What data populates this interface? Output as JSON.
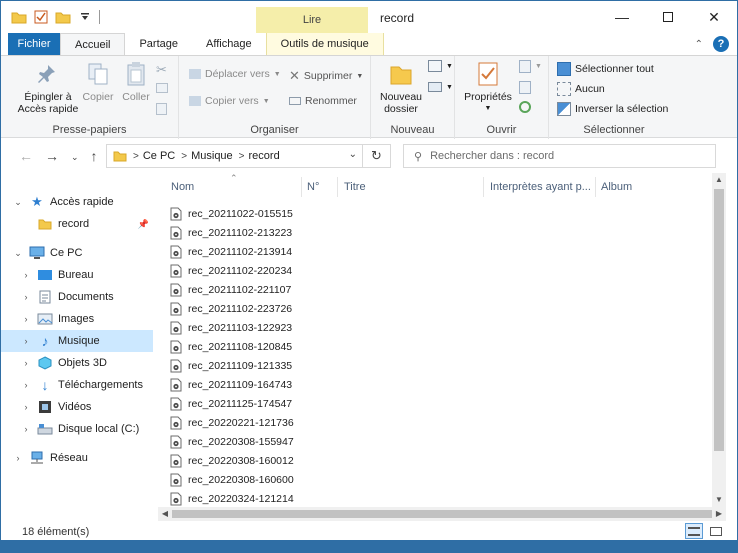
{
  "window": {
    "title": "record",
    "context_tab": "Lire"
  },
  "tabs": {
    "file": "Fichier",
    "home": "Accueil",
    "share": "Partage",
    "view": "Affichage",
    "music_tools": "Outils de musique"
  },
  "ribbon": {
    "clipboard": {
      "label": "Presse-papiers",
      "pin": "Épingler à\nAccès rapide",
      "copy": "Copier",
      "paste": "Coller"
    },
    "organize": {
      "label": "Organiser",
      "move_to": "Déplacer vers",
      "copy_to": "Copier vers",
      "delete": "Supprimer",
      "rename": "Renommer"
    },
    "new": {
      "label": "Nouveau",
      "new_folder": "Nouveau\ndossier"
    },
    "open": {
      "label": "Ouvrir",
      "properties": "Propriétés"
    },
    "select": {
      "label": "Sélectionner",
      "select_all": "Sélectionner tout",
      "select_none": "Aucun",
      "invert": "Inverser la sélection"
    }
  },
  "address": {
    "crumbs": [
      "Ce PC",
      "Musique",
      "record"
    ],
    "search_placeholder": "Rechercher dans : record"
  },
  "nav": {
    "quick_access": "Accès rapide",
    "record": "record",
    "this_pc": "Ce PC",
    "desktop": "Bureau",
    "documents": "Documents",
    "images": "Images",
    "music": "Musique",
    "objects3d": "Objets 3D",
    "downloads": "Téléchargements",
    "videos": "Vidéos",
    "local_disk": "Disque local (C:)",
    "network": "Réseau"
  },
  "columns": {
    "name": "Nom",
    "number": "N°",
    "title": "Titre",
    "artists": "Interprètes ayant p...",
    "album": "Album"
  },
  "files": [
    "rec_20211022-015515",
    "rec_20211102-213223",
    "rec_20211102-213914",
    "rec_20211102-220234",
    "rec_20211102-221107",
    "rec_20211102-223726",
    "rec_20211103-122923",
    "rec_20211108-120845",
    "rec_20211109-121335",
    "rec_20211109-164743",
    "rec_20211125-174547",
    "rec_20220221-121736",
    "rec_20220308-155947",
    "rec_20220308-160012",
    "rec_20220308-160600",
    "rec_20220324-121214"
  ],
  "status": {
    "count": "18 élément(s)"
  },
  "colors": {
    "accent": "#1a6fb5",
    "context_tab": "#f5eeaa",
    "selection": "#cce8ff"
  }
}
